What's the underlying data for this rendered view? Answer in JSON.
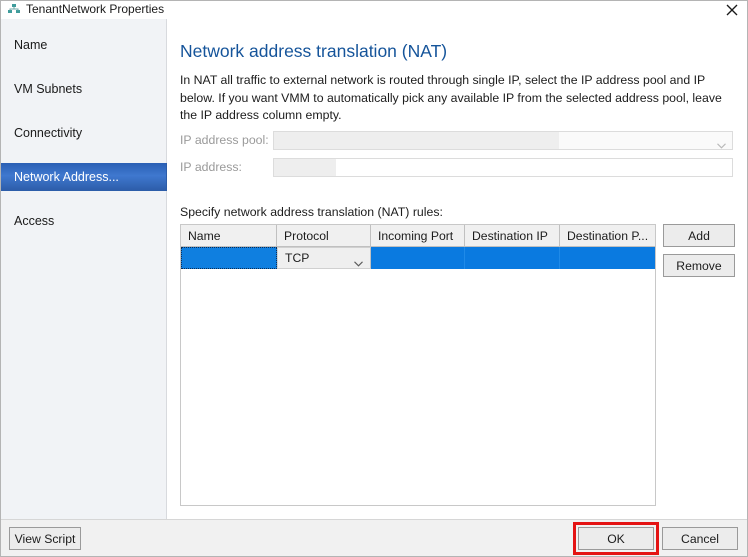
{
  "window": {
    "title": "TenantNetwork Properties",
    "icon": "network-logical-icon",
    "close_label": "close-icon"
  },
  "sidebar": {
    "items": [
      {
        "label": "Name",
        "selected": false
      },
      {
        "label": "VM Subnets",
        "selected": false
      },
      {
        "label": "Connectivity",
        "selected": false
      },
      {
        "label": "Network Address...",
        "selected": true
      },
      {
        "label": "Access",
        "selected": false
      }
    ]
  },
  "content": {
    "heading": "Network address translation (NAT)",
    "description": "In NAT all traffic to external network is routed through single IP, select the IP address pool and IP below. If you want VMM to automatically pick any available IP from the selected address pool, leave the IP address column empty.",
    "fields": [
      {
        "label": "IP address pool:",
        "value": "",
        "placeholder": "",
        "disabled": true,
        "type": "combobox"
      },
      {
        "label": "IP address:",
        "value": "",
        "placeholder": "",
        "disabled": true,
        "type": "text"
      }
    ],
    "rules_label": "Specify network address translation (NAT) rules:",
    "grid": {
      "columns": [
        "Name",
        "Protocol",
        "Incoming Port",
        "Destination IP",
        "Destination P..."
      ],
      "rows": [
        {
          "selected": true,
          "cells": [
            {
              "value": "",
              "type": "text",
              "focused": true
            },
            {
              "value": "TCP",
              "type": "combobox",
              "focused": false
            },
            {
              "value": "",
              "type": "text",
              "focused": false
            },
            {
              "value": "",
              "type": "text",
              "focused": false
            },
            {
              "value": "",
              "type": "text",
              "focused": false
            }
          ]
        }
      ]
    },
    "side_buttons": [
      {
        "label": "Add"
      },
      {
        "label": "Remove"
      }
    ]
  },
  "footer": {
    "view_script_label": "View Script",
    "ok_label": "OK",
    "cancel_label": "Cancel"
  },
  "annotations": {
    "ok_highlight_color": "#e41313"
  },
  "colors": {
    "heading": "#15549a",
    "selection_blue": "#0a7ae0",
    "sidebar_bg": "#f1f3f6",
    "nav_selected_start": "#2a5fb4",
    "nav_selected_end": "#2c5ca8"
  }
}
